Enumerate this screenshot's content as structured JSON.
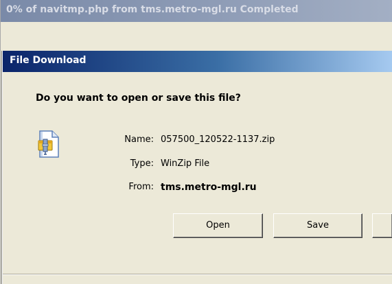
{
  "progress_window": {
    "title": "0% of navitmp.php from tms.metro-mgl.ru Completed"
  },
  "dialog": {
    "title": "File Download",
    "question": "Do you want to open or save this file?",
    "file_icon": "winzip-file-icon",
    "fields": {
      "name_label": "Name:",
      "name_value": "057500_120522-1137.zip",
      "type_label": "Type:",
      "type_value": "WinZip File",
      "from_label": "From:",
      "from_value": "tms.metro-mgl.ru"
    },
    "buttons": {
      "open_label": "Open",
      "save_label": "Save",
      "cancel_label": ""
    }
  },
  "colors": {
    "dialog_title_active": "#0a246a",
    "window_bg": "#ece9d8",
    "inactive_title": "#8e9cb6"
  }
}
